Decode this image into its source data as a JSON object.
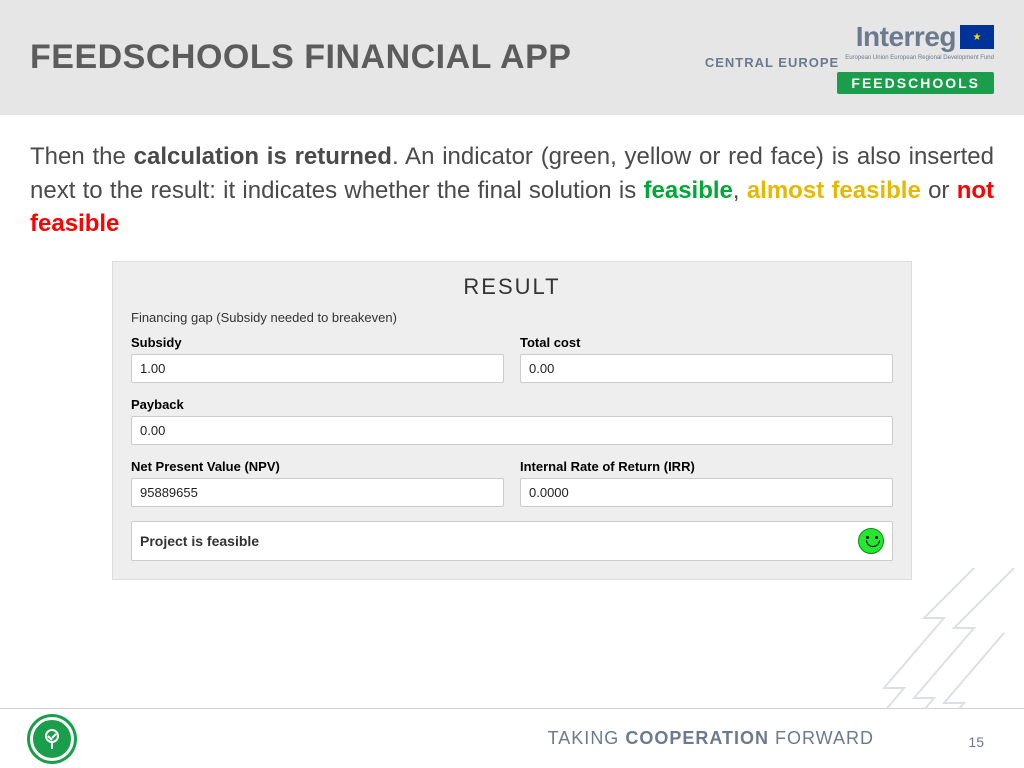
{
  "header": {
    "title": "FEEDSCHOOLS FINANCIAL APP",
    "logo": {
      "interreg": "Interreg",
      "region": "CENTRAL EUROPE",
      "fund": "European Union\nEuropean Regional\nDevelopment Fund",
      "project": "FEEDSCHOOLS"
    }
  },
  "body": {
    "pre": "Then the ",
    "bold": "calculation is returned",
    "after_bold": ". An indicator (green, yellow or red face) is also inserted next to the result: it indicates whether the final solution is ",
    "feasible": "feasible",
    "sep1": ", ",
    "almost": "almost feasible",
    "sep2": " or ",
    "notfeasible": "not feasible"
  },
  "result": {
    "title": "RESULT",
    "gap_label": "Financing gap (Subsidy needed to breakeven)",
    "subsidy_label": "Subsidy",
    "subsidy_value": "1.00",
    "totalcost_label": "Total cost",
    "totalcost_value": "0.00",
    "payback_label": "Payback",
    "payback_value": "0.00",
    "npv_label": "Net Present Value (NPV)",
    "npv_value": "95889655",
    "irr_label": "Internal Rate of Return (IRR)",
    "irr_value": "0.0000",
    "status_text": "Project is feasible"
  },
  "footer": {
    "tagline_pre": "TAKING ",
    "tagline_bold": "COOPERATION",
    "tagline_post": " FORWARD",
    "page": "15"
  }
}
